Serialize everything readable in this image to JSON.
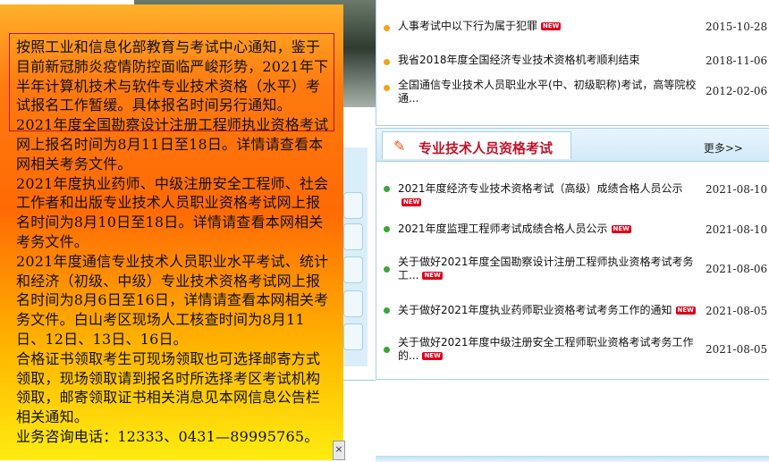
{
  "popup": {
    "paragraphs": [
      "按照工业和信息化部教育与考试中心通知，鉴于目前新冠肺炎疫情防控面临严峻形势，2021年下半年计算机技术与软件专业技术资格（水平）考试报名工作暂缓。具体报名时间另行通知。",
      "2021年度全国勘察设计注册工程师执业资格考试网上报名时间为8月11日至18日。详情请查看本网相关考务文件。",
      "2021年度执业药师、中级注册安全工程师、社会工作者和出版专业技术人员职业资格考试网上报名时间为8月10日至18日。详情请查看本网相关考务文件。",
      "2021年度通信专业技术人员职业水平考试、统计和经济（初级、中级）专业技术资格考试网上报名时间为8月6日至16日，详情请查看本网相关考务文件。白山考区现场人工核查时间为8月11日、12日、13日、16日。",
      "合格证书领取考生可现场领取也可选择邮寄方式领取，现场领取请到报名时所选择考区考试机构领取，邮寄领取证书相关消息见本网信息公告栏相关通知。",
      "业务咨询电话：12333、0431—89995765。"
    ],
    "close_label": "×"
  },
  "top_news": [
    {
      "title": "人事考试中以下行为属于犯罪",
      "new": true,
      "date": "2015-10-28"
    },
    {
      "title": "我省2018年度全国经济专业技术资格机考顺利结束",
      "new": false,
      "date": "2018-11-06"
    },
    {
      "title": "全国通信专业技术人员职业水平(中、初级职称)考试，高等院校通...",
      "new": false,
      "date": "2012-02-06"
    }
  ],
  "section": {
    "title": "专业技术人员资格考试",
    "more_label": "更多>>"
  },
  "section_news": [
    {
      "title": "2021年度经济专业技术资格考试（高级）成绩合格人员公示",
      "new": true,
      "date": "2021-08-10"
    },
    {
      "title": "2021年度监理工程师考试成绩合格人员公示",
      "new": true,
      "date": "2021-08-10"
    },
    {
      "title": "关于做好2021年度全国勘察设计注册工程师执业资格考试考务工...",
      "new": true,
      "date": "2021-08-06"
    },
    {
      "title": "关于做好2021年度执业药师职业资格考试考务工作的通知",
      "new": true,
      "date": "2021-08-05"
    },
    {
      "title": "关于做好2021年度中级注册安全工程师职业资格考试考务工作的...",
      "new": true,
      "date": "2021-08-05"
    }
  ],
  "new_badge_label": "NEW",
  "colors": {
    "accent_red": "#c0142a",
    "panel_border": "#a9cfe8",
    "bullet_orange": "#f2a21c",
    "bullet_green": "#3aa53a"
  }
}
